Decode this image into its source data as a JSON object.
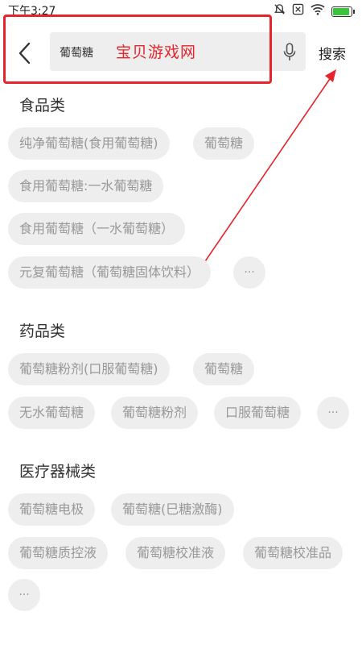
{
  "status_bar": {
    "time": "下午3:27",
    "icons": [
      "mute-icon",
      "notification-close-icon",
      "wifi-icon",
      "battery-charging-icon"
    ],
    "battery_color": "#3bc33b"
  },
  "header": {
    "search_value": "葡萄糖",
    "search_button": "搜索",
    "watermark": "宝贝游戏网",
    "annotation_color": "#e5242b"
  },
  "categories": [
    {
      "title": "食品类",
      "tags": [
        "纯净葡萄糖(食用葡萄糖)",
        "葡萄糖",
        "食用葡萄糖:一水葡萄糖",
        "食用葡萄糖（一水葡萄糖）",
        "元复葡萄糖（葡萄糖固体饮料）"
      ],
      "more": "···"
    },
    {
      "title": "药品类",
      "tags": [
        "葡萄糖粉剂(口服葡萄糖)",
        "葡萄糖",
        "无水葡萄糖",
        "葡萄糖粉剂",
        "口服葡萄糖"
      ],
      "more": "···"
    },
    {
      "title": "医疗器械类",
      "tags": [
        "葡萄糖电极",
        "葡萄糖(巳糖激酶)",
        "葡萄糖质控液",
        "葡萄糖校准液",
        "葡萄糖校准品"
      ],
      "more": "···"
    }
  ]
}
